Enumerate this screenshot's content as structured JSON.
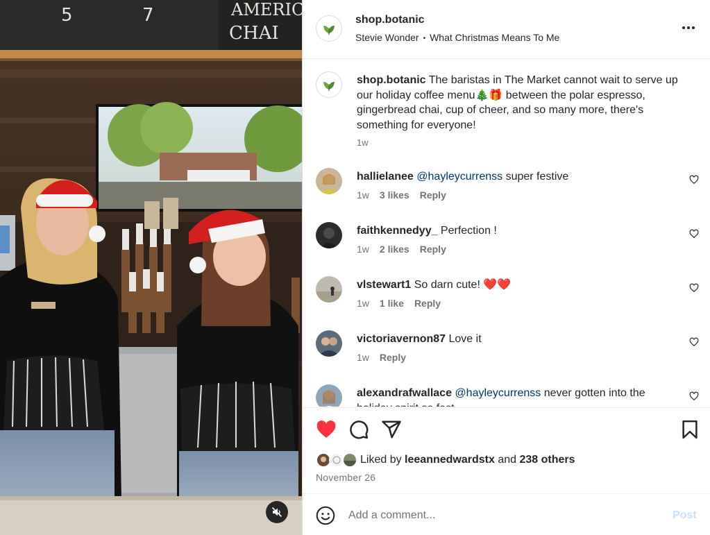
{
  "video": {
    "menu_board_numbers": [
      "5",
      "7"
    ],
    "menu_board_text": [
      "AMERICA",
      "CHAI"
    ]
  },
  "post": {
    "username": "shop.botanic",
    "audio_artist": "Stevie Wonder",
    "audio_separator": "•",
    "audio_title": "What Christmas Means To Me",
    "caption_username": "shop.botanic",
    "caption_text": " The baristas in The Market cannot wait to serve up our holiday coffee menu🎄🎁 between the polar espresso, gingerbread chai, cup of cheer, and so many more, there's something for everyone!",
    "caption_time": "1w"
  },
  "comments": [
    {
      "username": "hallielanee",
      "mention": "@hayleycurrenss",
      "text": " super festive",
      "time": "1w",
      "likes": "3 likes",
      "reply": "Reply",
      "avatar_color": "#c9b59a"
    },
    {
      "username": "faithkennedyy_",
      "mention": "",
      "text": " Perfection !",
      "time": "1w",
      "likes": "2 likes",
      "reply": "Reply",
      "avatar_color": "#2b2b2b"
    },
    {
      "username": "vlstewart1",
      "mention": "",
      "text": " So darn cute! ❤️❤️",
      "time": "1w",
      "likes": "1 like",
      "reply": "Reply",
      "avatar_color": "#a6a39a"
    },
    {
      "username": "victoriavernon87",
      "mention": "",
      "text": " Love it",
      "time": "1w",
      "likes": "",
      "reply": "Reply",
      "avatar_color": "#5d6b78"
    },
    {
      "username": "alexandrafwallace",
      "mention": "@hayleycurrenss",
      "text": " never gotten into the holiday spirit so fast",
      "time": "",
      "likes": "",
      "reply": "",
      "avatar_color": "#8ea6b8"
    }
  ],
  "actions": {
    "liked": true,
    "liked_by_prefix": "Liked by ",
    "liked_by_user": "leeannedwardstx",
    "liked_by_and": " and ",
    "liked_by_others": "238 others",
    "date": "November 26"
  },
  "comment_box": {
    "placeholder": "Add a comment...",
    "post_label": "Post"
  },
  "colors": {
    "like_red": "#ff3040",
    "mention_blue": "#00376b",
    "post_disabled": "#c6e0fb",
    "muted_text": "#737373"
  }
}
